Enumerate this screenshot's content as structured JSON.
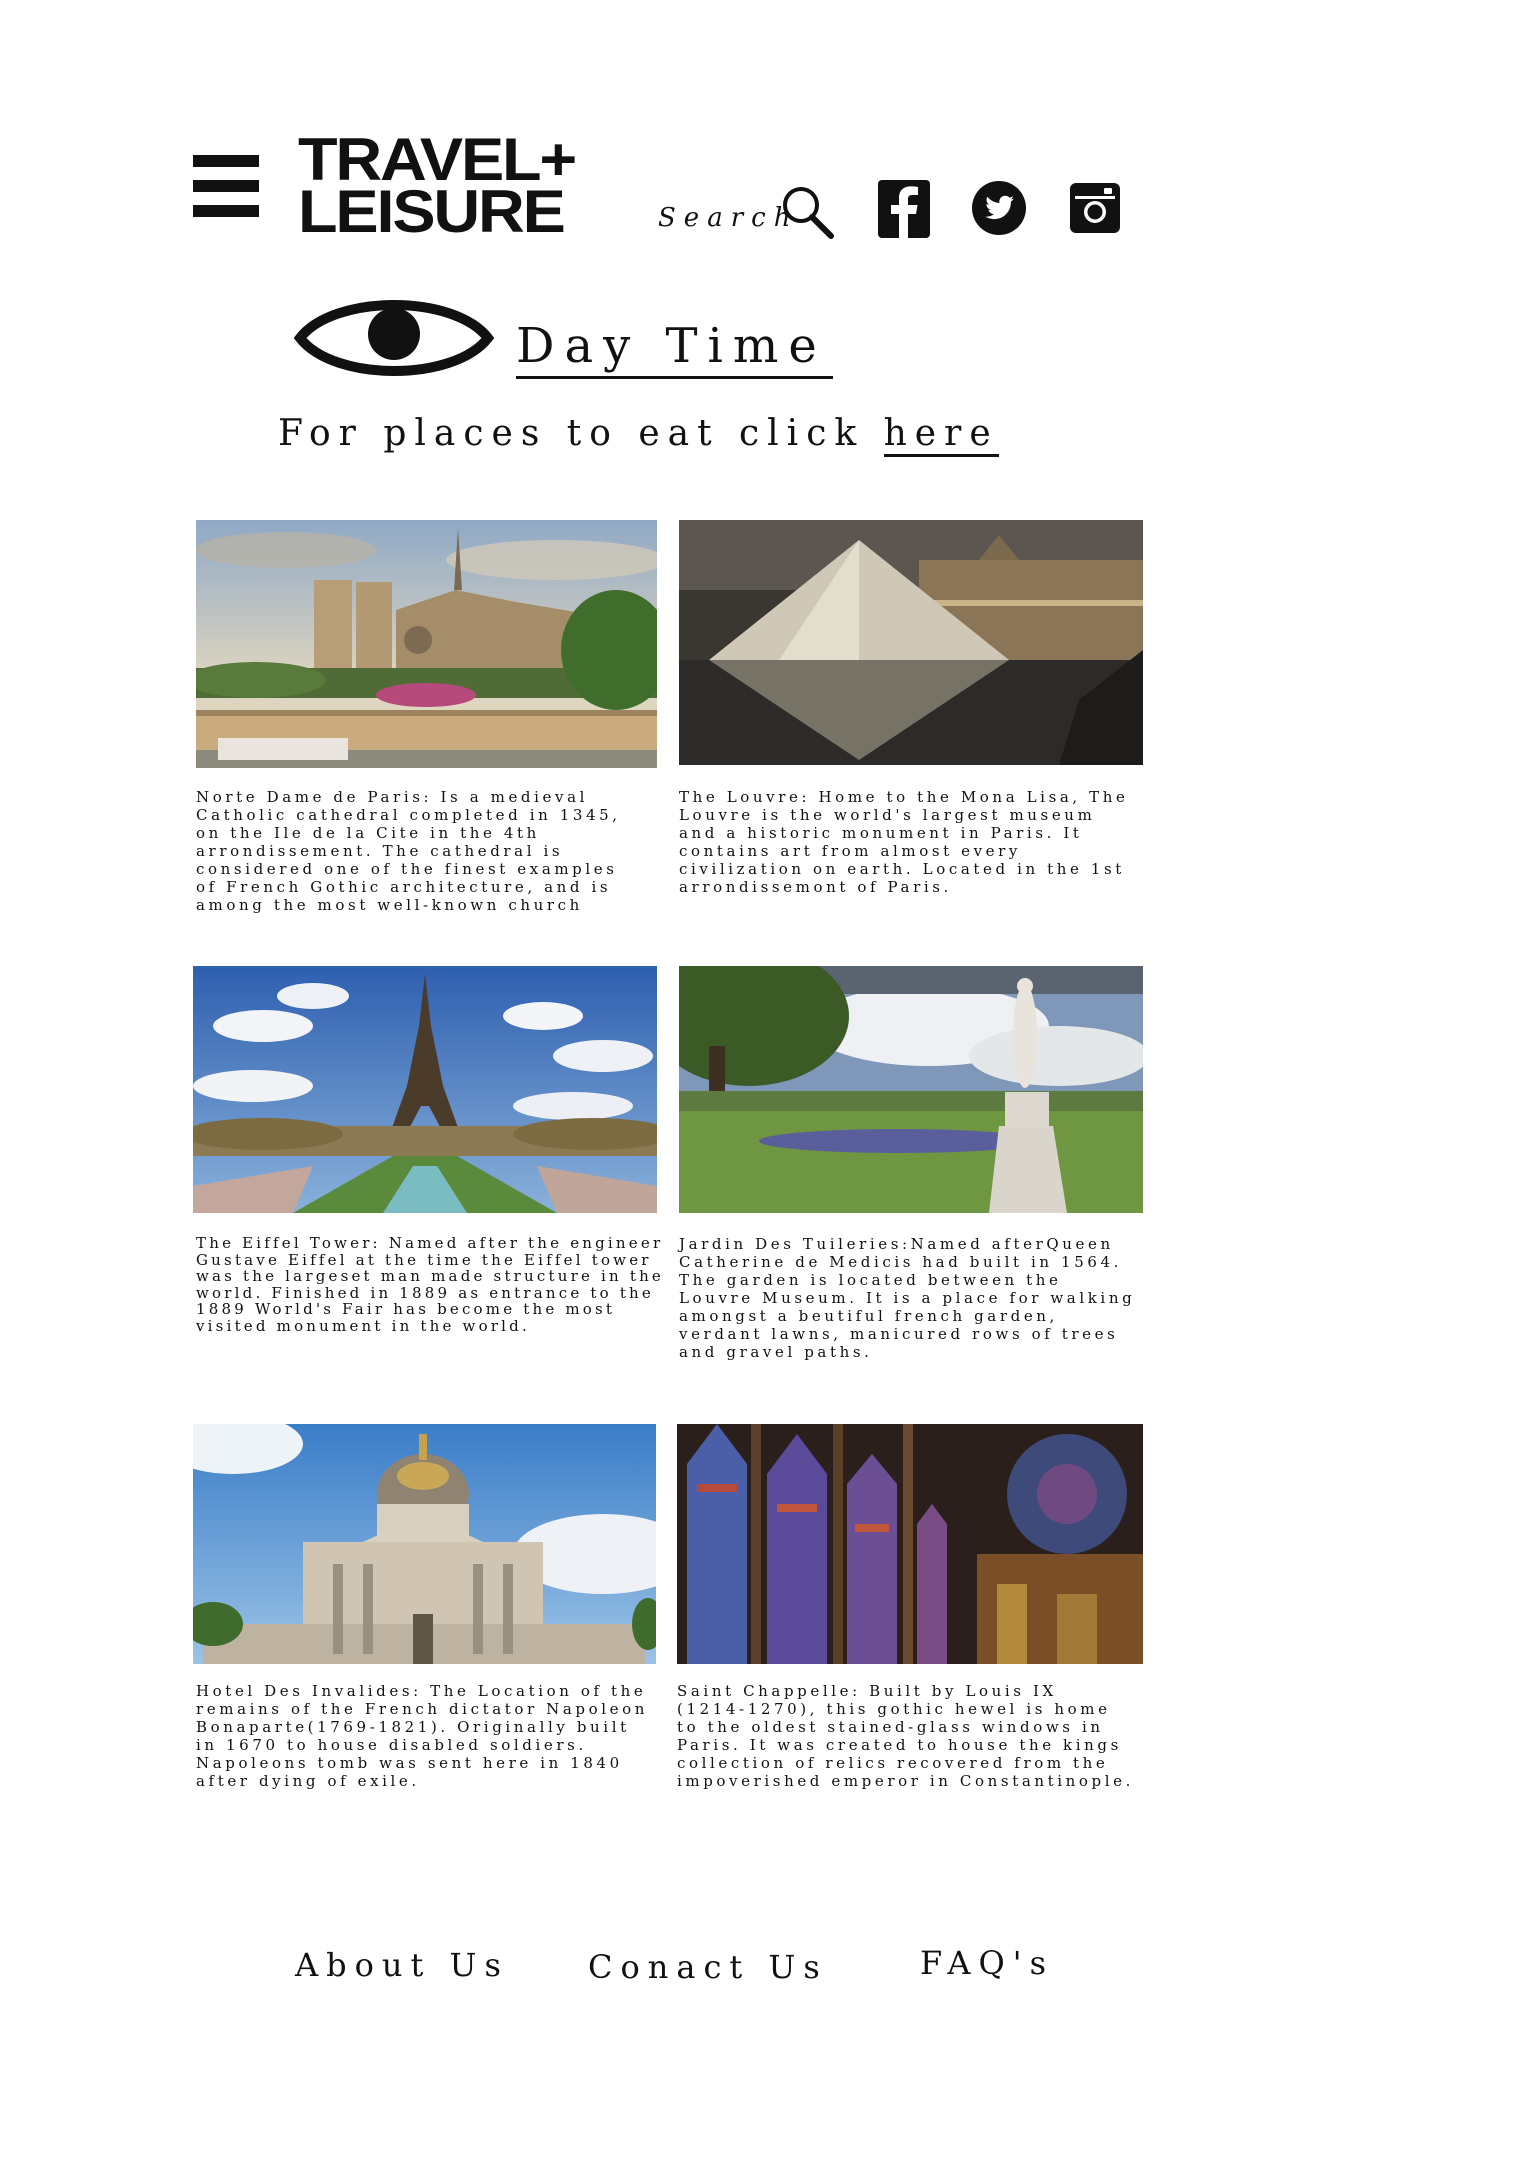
{
  "header": {
    "logo_line1": "TRAVEL+",
    "logo_line2": "LEISURE",
    "search_label": "Search",
    "social": [
      "facebook-icon",
      "twitter-icon",
      "instagram-icon"
    ]
  },
  "section": {
    "title": "Day Time",
    "eat_prefix": "For places to eat click",
    "eat_link": "here"
  },
  "places": [
    {
      "name": "notre-dame",
      "lines": [
        "Norte Dame de Paris: Is a medieval",
        "Catholic cathedral completed in 1345,",
        "on the Ile de la Cite in the 4th",
        "arrondissement. The cathedral is",
        "considered one of the finest examples",
        "of French Gothic architecture, and is",
        "among the most well-known church"
      ]
    },
    {
      "name": "louvre",
      "lines": [
        "The Louvre: Home to the Mona Lisa, The",
        "Louvre is the world's largest museum",
        "and a historic monument in Paris. It",
        "contains art from almost every",
        "civilization on earth. Located in the 1st",
        "arrondissemont of Paris."
      ]
    },
    {
      "name": "eiffel-tower",
      "lines": [
        "The Eiffel Tower: Named after the engineer",
        "Gustave Eiffel at the time the Eiffel tower",
        "was the largeset man made structure in the",
        "world. Finished in 1889 as entrance to the",
        "1889 World's Fair has become the most",
        "visited monument in the world."
      ]
    },
    {
      "name": "tuileries",
      "lines": [
        "Jardin Des Tuileries:Named afterQueen",
        "Catherine de Medicis had built in 1564.",
        "The garden is located between the",
        "Louvre Museum. It is a place for walking",
        "amongst a beutiful french garden,",
        "verdant lawns, manicured rows of trees",
        "and gravel paths."
      ]
    },
    {
      "name": "invalides",
      "lines": [
        "Hotel Des Invalides: The Location of the",
        "remains of the French dictator Napoleon",
        "Bonaparte(1769-1821). Originally built",
        "in 1670 to house disabled soldiers.",
        "Napoleons tomb was sent here in 1840",
        "after dying of exile."
      ]
    },
    {
      "name": "sainte-chapelle",
      "lines": [
        "Saint Chappelle: Built by Louis IX",
        "(1214-1270), this gothic hewel is home",
        "to the oldest stained-glass windows in",
        "Paris. It was created to house the kings",
        "collection of relics recovered from the",
        "impoverished emperor in Constantinople."
      ]
    }
  ],
  "footer": {
    "about": "About Us",
    "contact": "Conact Us",
    "faq": "FAQ's"
  }
}
